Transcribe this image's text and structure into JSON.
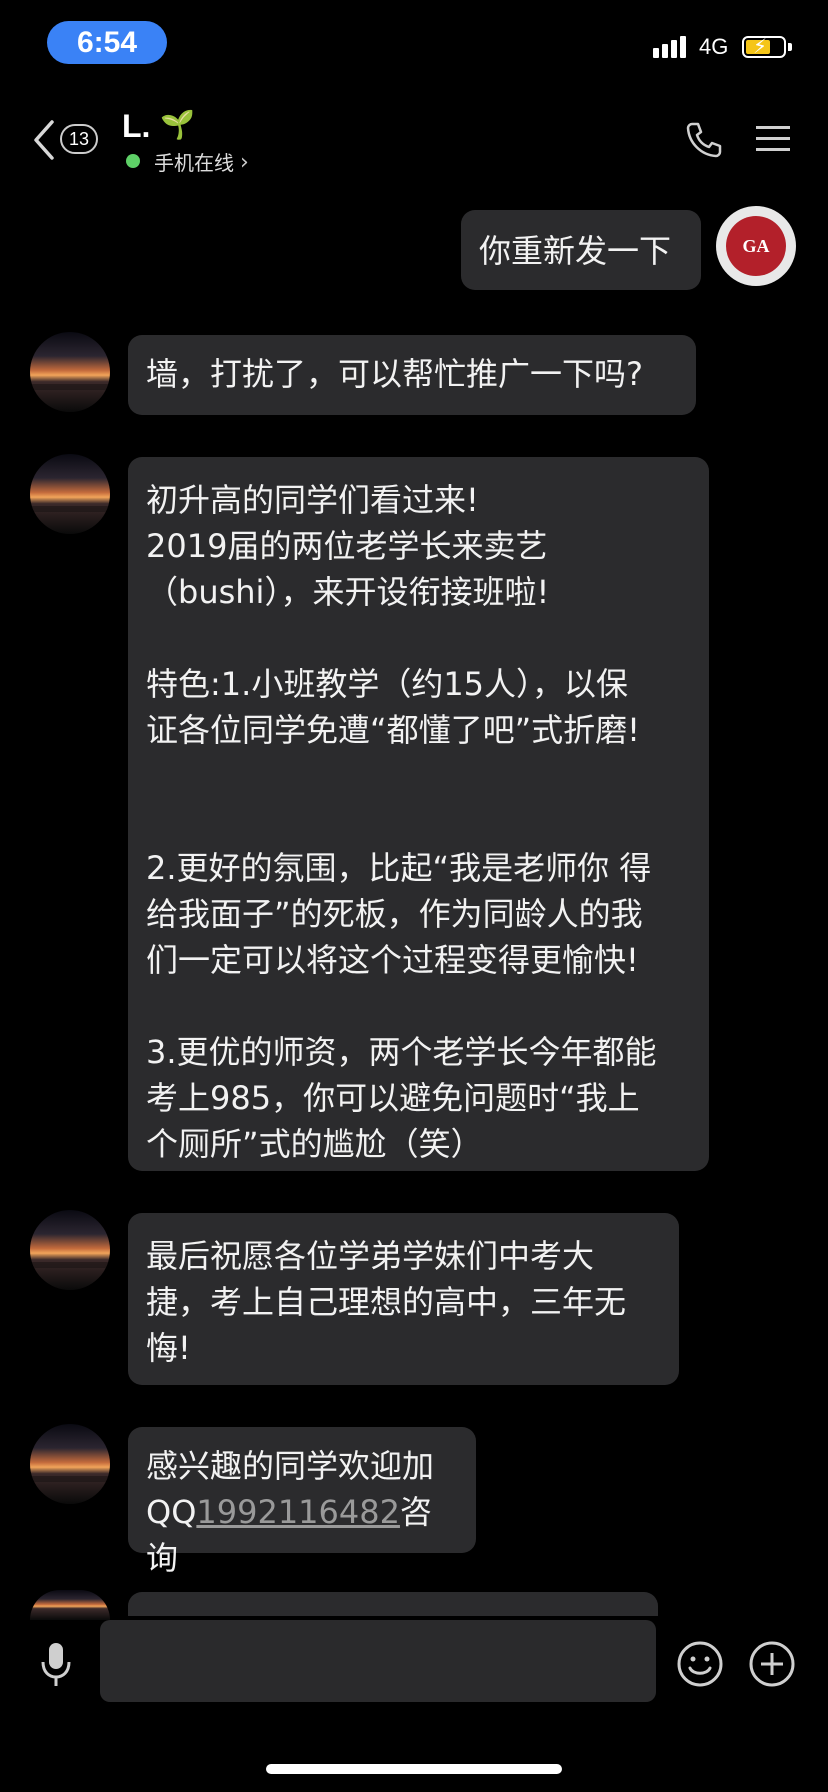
{
  "status_bar": {
    "time": "6:54",
    "network": "4G"
  },
  "header": {
    "unread_count": "13",
    "contact_name": "L.",
    "contact_emoji": "🌱",
    "online_status": "手机在线",
    "chevron": "›"
  },
  "messages": [
    {
      "side": "right",
      "text": "你重新发一下"
    },
    {
      "side": "left",
      "text": "墙，打扰了，可以帮忙推广一下吗?"
    },
    {
      "side": "left",
      "text": "初升高的同学们看过来!\n2019届的两位老学长来卖艺\n（bushi），来开设衔接班啦!\n\n特色:1.小班教学（约15人），以保\n证各位同学免遭“都懂了吧”式折磨!\n\n\n2.更好的氛围，比起“我是老师你 得\n给我面子”的死板，作为同龄人的我\n们一定可以将这个过程变得更愉快!\n\n3.更优的师资，两个老学长今年都能\n考上985，你可以避免问题时“我上\n个厕所”式的尴尬（笑）"
    },
    {
      "side": "left",
      "text": "最后祝愿各位学弟学妹们中考大\n捷，考上自己理想的高中，三年无\n悔!"
    },
    {
      "side": "left",
      "text_before": "感兴趣的同学欢迎加\nQQ",
      "link": "1992116482",
      "text_after": "咨询"
    }
  ],
  "my_avatar_text": "GA",
  "colors": {
    "background": "#000000",
    "bubble": "#2b2b2d",
    "time_pill": "#3a82f6",
    "online": "#5ed067",
    "battery": "#f5c518"
  }
}
